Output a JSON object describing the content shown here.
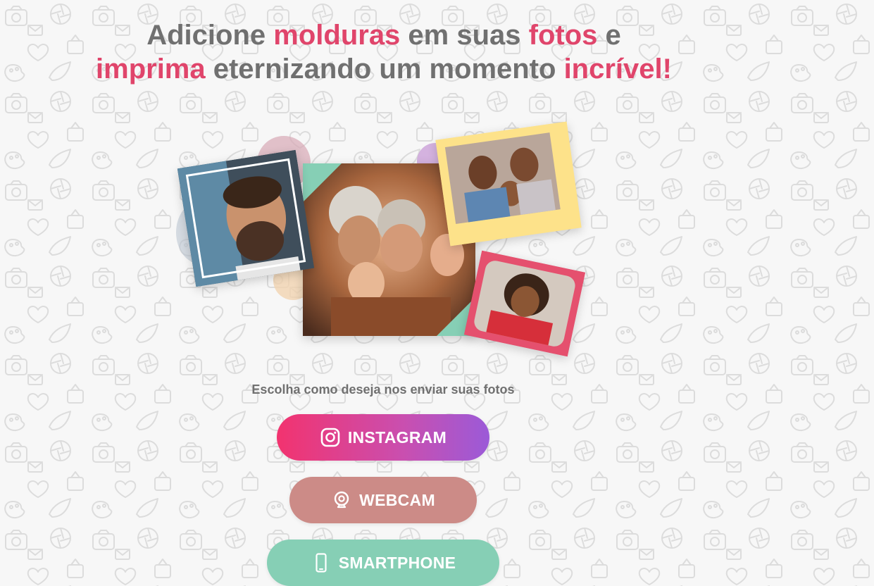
{
  "headline": {
    "line1": [
      {
        "text": "Adicione ",
        "accent": false
      },
      {
        "text": "molduras",
        "accent": true
      },
      {
        "text": " em suas ",
        "accent": false
      },
      {
        "text": "fotos",
        "accent": true
      },
      {
        "text": " e",
        "accent": false
      }
    ],
    "line2": [
      {
        "text": "imprima",
        "accent": true
      },
      {
        "text": " eternizando um momento ",
        "accent": false
      },
      {
        "text": "incrível!",
        "accent": true
      }
    ]
  },
  "prompt": "Escolha como deseja nos enviar suas fotos",
  "buttons": {
    "instagram": "INSTAGRAM",
    "webcam": "WEBCAM",
    "smartphone": "SMARTPHONE"
  },
  "colors": {
    "accent": "#e0456b",
    "text_gray": "#707070",
    "instagram_gradient": [
      "#f2336f",
      "#c94fb0",
      "#9b5ad8"
    ],
    "webcam": "#cc8b87",
    "smartphone": "#86cfb5",
    "frame_yellow": "#fde28a",
    "frame_pink": "#e5506e",
    "frame_mint": "#86cfb5"
  },
  "icons": [
    "instagram-icon",
    "webcam-icon",
    "smartphone-icon"
  ]
}
